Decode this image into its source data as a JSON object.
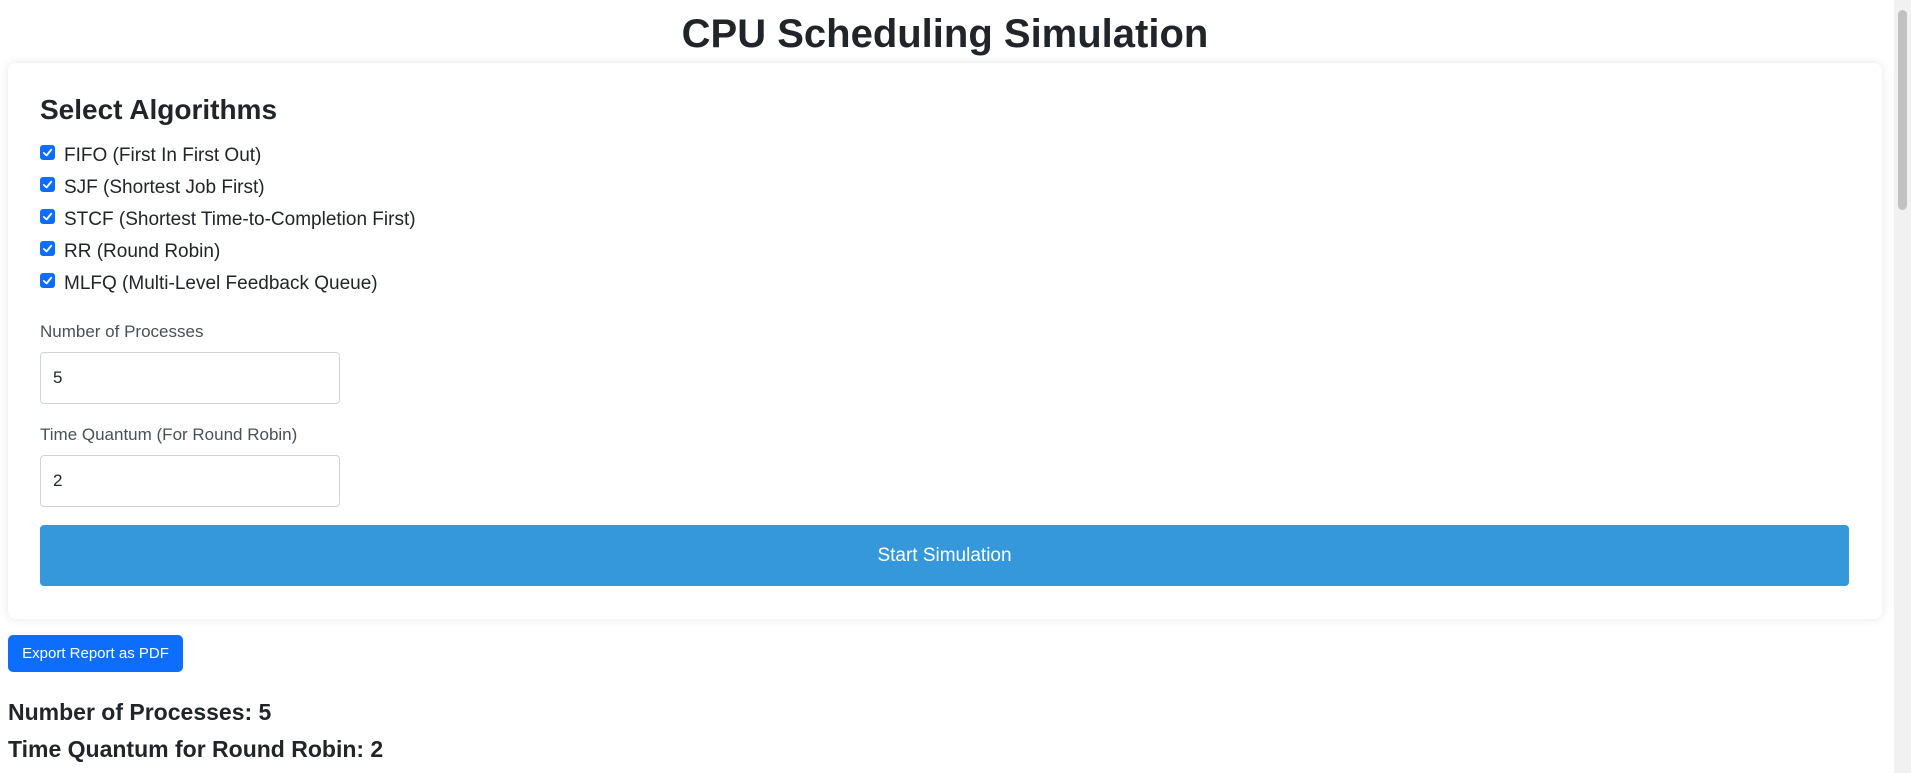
{
  "page": {
    "title": "CPU Scheduling Simulation"
  },
  "form": {
    "section_title": "Select Algorithms",
    "algorithms": [
      {
        "label": "FIFO (First In First Out)",
        "checked": true
      },
      {
        "label": "SJF (Shortest Job First)",
        "checked": true
      },
      {
        "label": "STCF (Shortest Time-to-Completion First)",
        "checked": true
      },
      {
        "label": "RR (Round Robin)",
        "checked": true
      },
      {
        "label": "MLFQ (Multi-Level Feedback Queue)",
        "checked": true
      }
    ],
    "num_processes_label": "Number of Processes",
    "num_processes_value": "5",
    "time_quantum_label": "Time Quantum (For Round Robin)",
    "time_quantum_value": "2",
    "start_button": "Start Simulation"
  },
  "actions": {
    "export_button": "Export Report as PDF"
  },
  "summary": {
    "num_processes": "Number of Processes: 5",
    "time_quantum": "Time Quantum for Round Robin: 2"
  },
  "colors": {
    "primary_button": "#3498db",
    "export_button": "#0d6efd",
    "checkbox": "#0d6efd"
  }
}
